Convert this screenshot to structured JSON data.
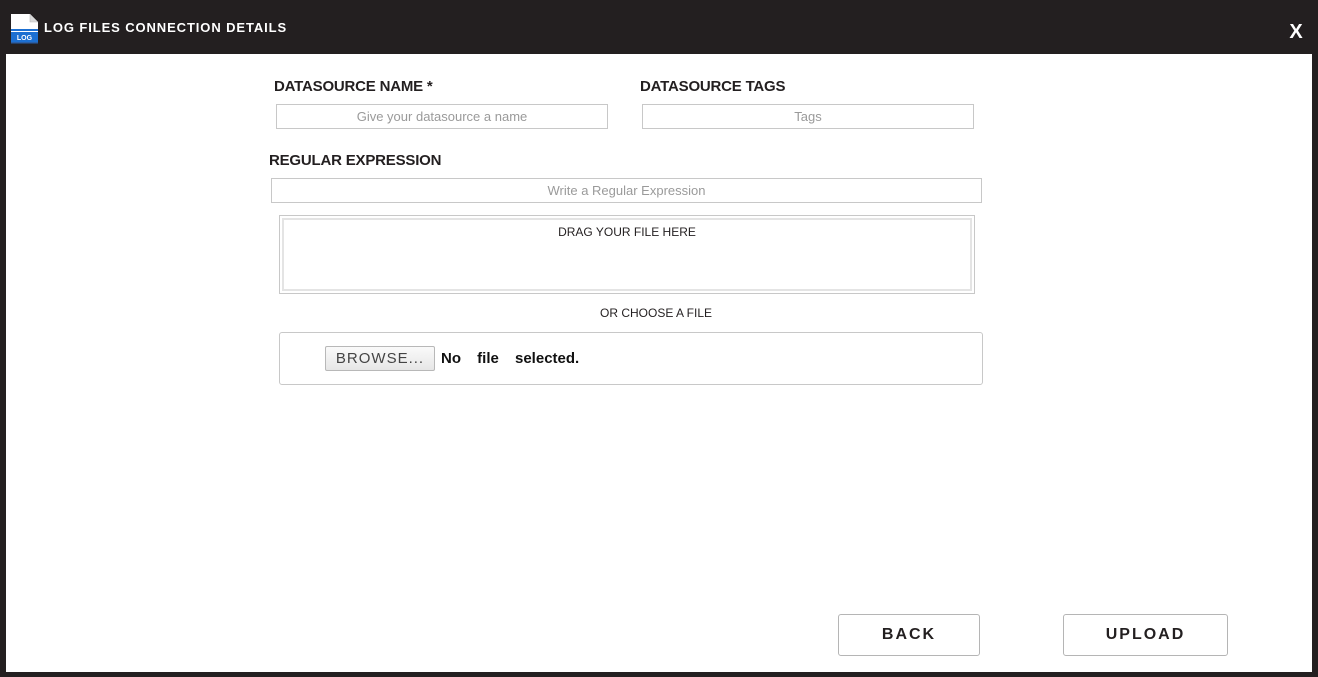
{
  "window": {
    "title": "LOG FILES CONNECTION DETAILS",
    "icon_text": "LOG",
    "close_label": "X"
  },
  "form": {
    "datasource_name": {
      "label": "DATASOURCE NAME *",
      "value": "",
      "placeholder": "Give your datasource a name"
    },
    "datasource_tags": {
      "label": "DATASOURCE TAGS",
      "value": "",
      "placeholder": "Tags"
    },
    "regular_expression": {
      "label": "REGULAR EXPRESSION",
      "value": "",
      "placeholder": "Write a Regular Expression"
    }
  },
  "upload": {
    "dropzone_text": "DRAG YOUR FILE HERE",
    "or_text": "OR CHOOSE A FILE",
    "browse_label": "BROWSE...",
    "file_status": "No file selected."
  },
  "actions": {
    "back_label": "BACK",
    "upload_label": "UPLOAD"
  },
  "colors": {
    "titlebar_bg": "#231f20",
    "icon_blue": "#1c6fd1"
  }
}
